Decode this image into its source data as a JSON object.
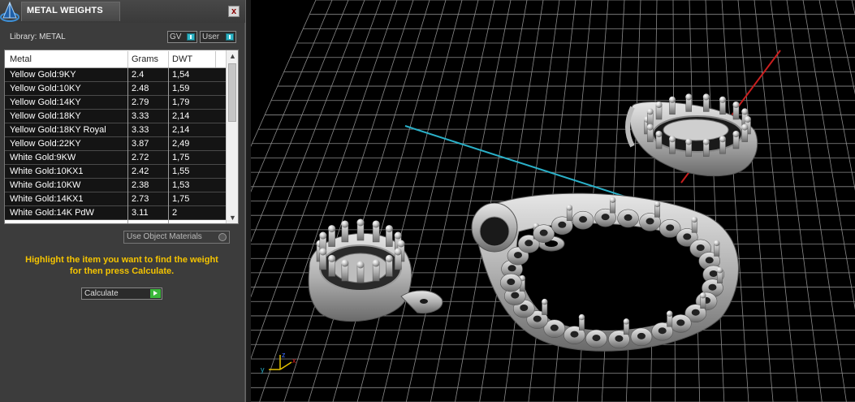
{
  "panel": {
    "title": "METAL WEIGHTS",
    "close_label": "x",
    "library_label": "Library: METAL",
    "gv_label": "GV",
    "user_label": "User",
    "use_object_materials": "Use Object Materials",
    "hint_line1": "Highlight the item you want to find the weight",
    "hint_line2": "for then press Calculate.",
    "calculate_label": "Calculate"
  },
  "table": {
    "columns": [
      "Metal",
      "Grams",
      "DWT"
    ],
    "rows": [
      {
        "metal": "Yellow Gold:9KY",
        "grams": "2.4",
        "dwt": "1,54"
      },
      {
        "metal": "Yellow Gold:10KY",
        "grams": "2.48",
        "dwt": "1,59"
      },
      {
        "metal": "Yellow Gold:14KY",
        "grams": "2.79",
        "dwt": "1,79"
      },
      {
        "metal": "Yellow Gold:18KY",
        "grams": "3.33",
        "dwt": "2,14"
      },
      {
        "metal": "Yellow Gold:18KY Royal",
        "grams": "3.33",
        "dwt": "2,14"
      },
      {
        "metal": "Yellow Gold:22KY",
        "grams": "3.87",
        "dwt": "2,49"
      },
      {
        "metal": "White Gold:9KW",
        "grams": "2.72",
        "dwt": "1,75"
      },
      {
        "metal": "White Gold:10KX1",
        "grams": "2.42",
        "dwt": "1,55"
      },
      {
        "metal": "White Gold:10KW",
        "grams": "2.38",
        "dwt": "1,53"
      },
      {
        "metal": "White Gold:14KX1",
        "grams": "2.73",
        "dwt": "1,75"
      },
      {
        "metal": "White Gold:14K PdW",
        "grams": "3.11",
        "dwt": "2"
      }
    ]
  },
  "viewport": {
    "axis_y": "y",
    "axis_z": "z",
    "axis_x": "x"
  },
  "colors": {
    "panel_bg": "#3c3c3c",
    "hint": "#f5c400",
    "grid": "#8a8a8a",
    "axis_red": "#c81e1e",
    "axis_cyan": "#2ab0c8",
    "metal": "#c8c8c8"
  },
  "icons": {
    "logo": "pyramid-logo-icon",
    "close": "close-icon",
    "toggle": "toggle-knob-icon",
    "calculate": "play-arrow-icon"
  }
}
